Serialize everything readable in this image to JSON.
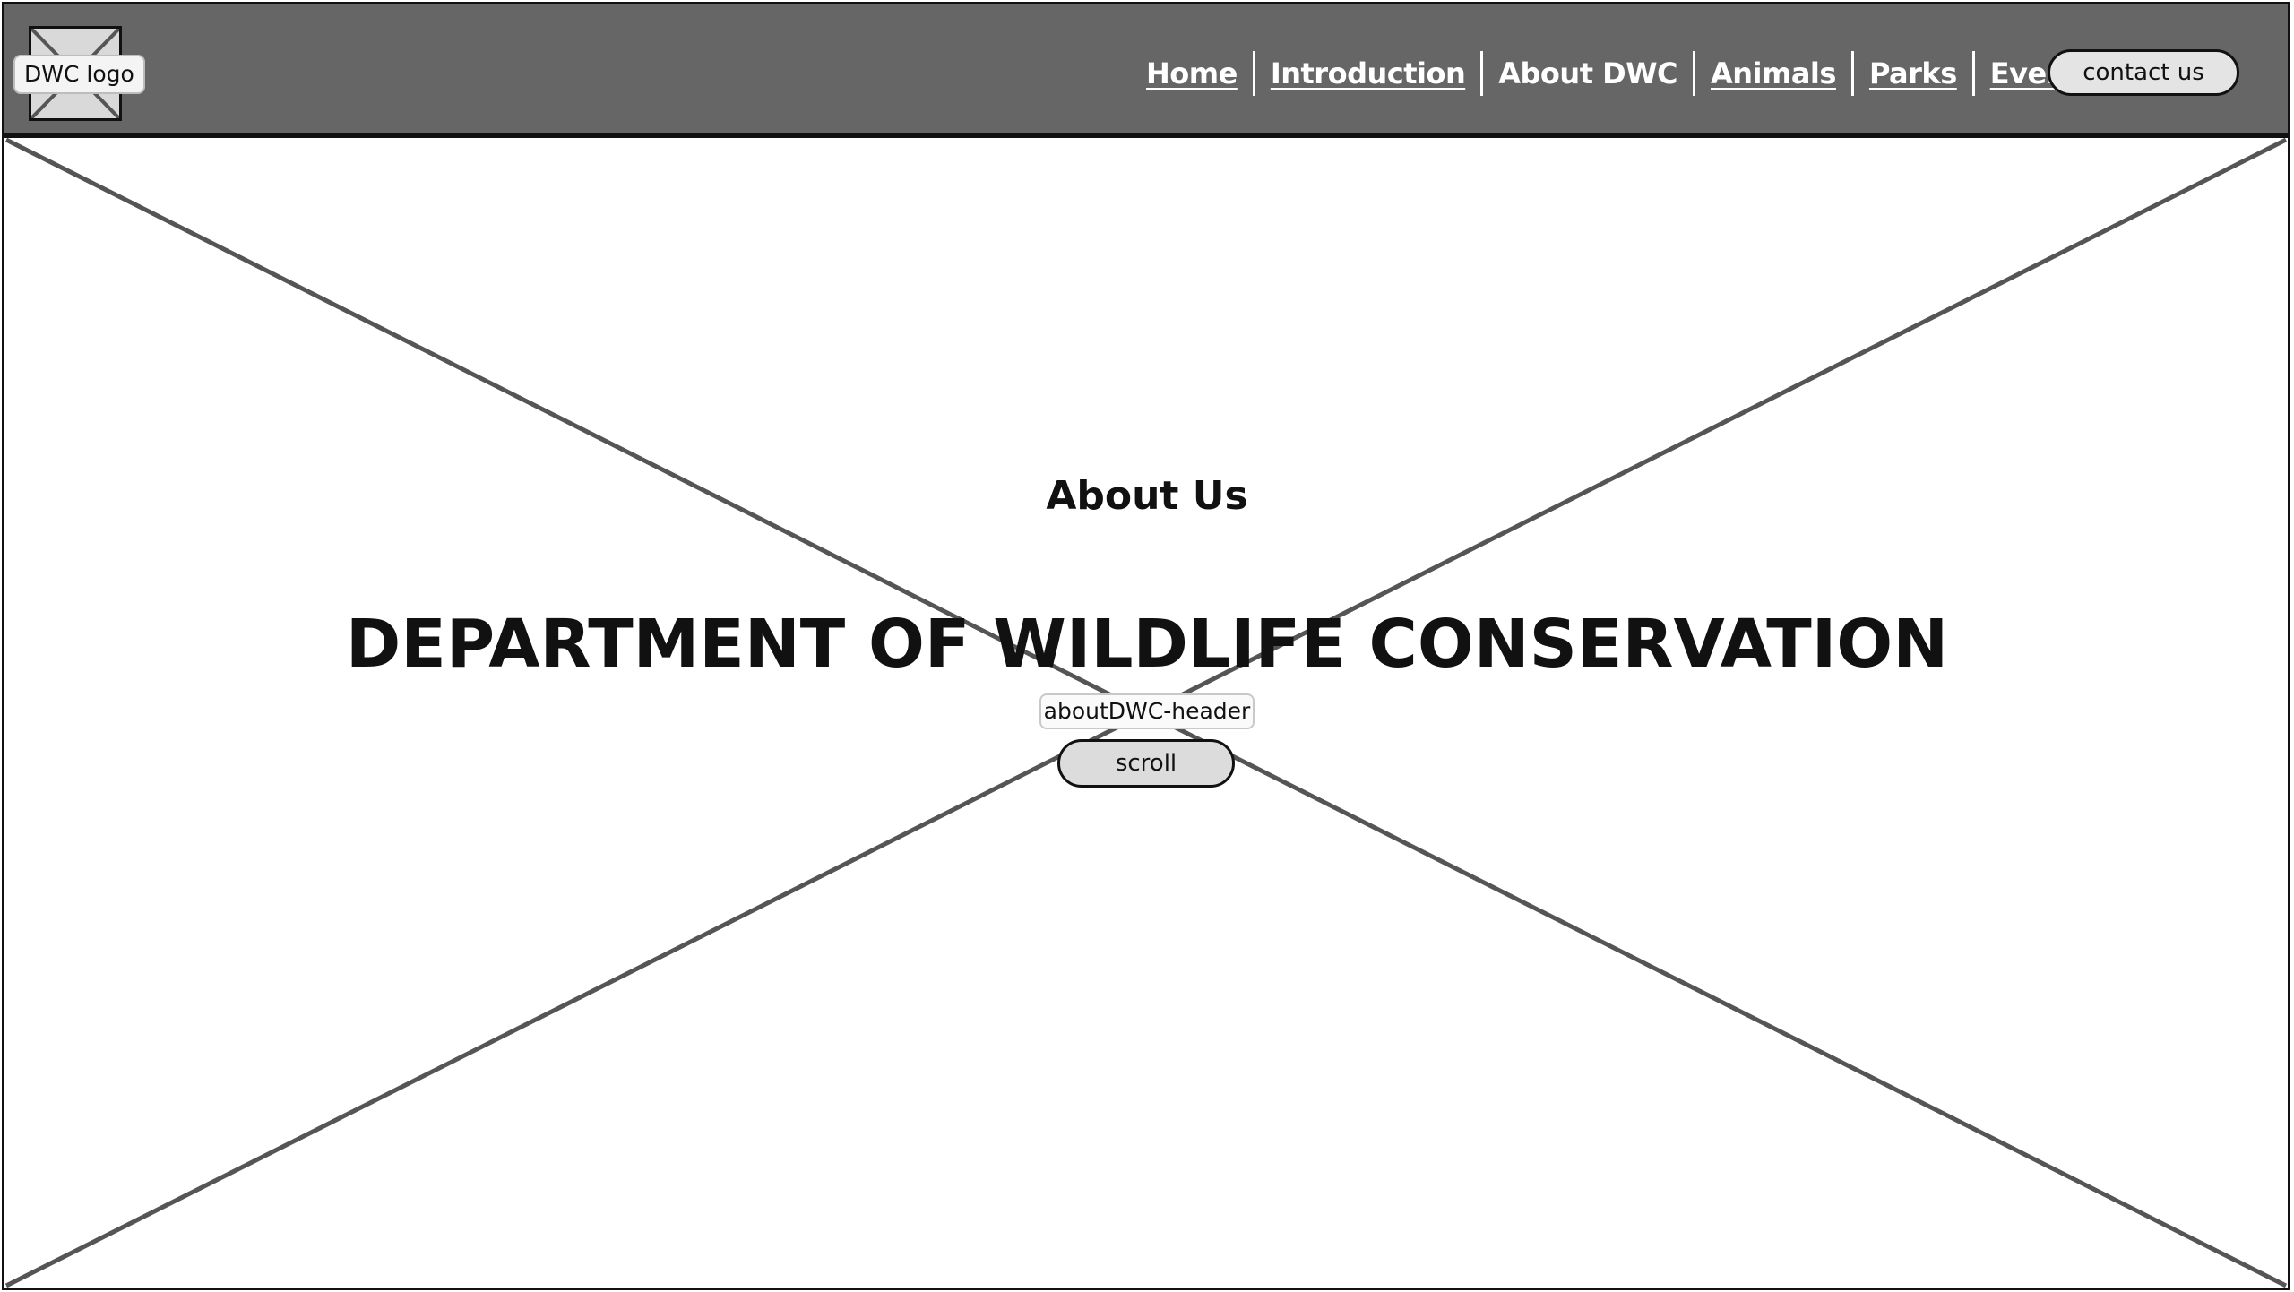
{
  "header": {
    "logo_label": "DWC logo",
    "nav": [
      {
        "label": "Home",
        "current": false
      },
      {
        "label": "Introduction",
        "current": false
      },
      {
        "label": "About DWC",
        "current": true
      },
      {
        "label": "Animals",
        "current": false
      },
      {
        "label": "Parks",
        "current": false
      },
      {
        "label": "Events",
        "current": false
      }
    ],
    "contact_label": "contact us",
    "background_color": "#666666"
  },
  "hero": {
    "section_title": "About Us",
    "main_title": "DEPARTMENT OF WILDLIFE CONSERVATION",
    "image_label": "aboutDWC-header",
    "scroll_label": "scroll"
  }
}
